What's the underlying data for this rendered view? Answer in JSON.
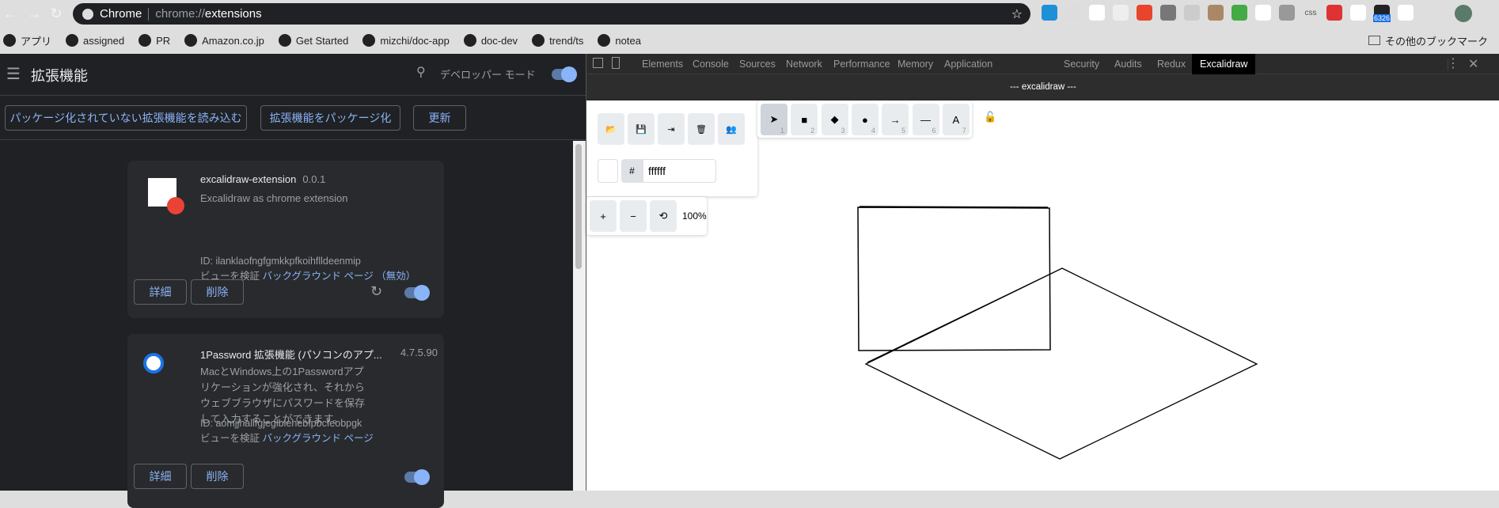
{
  "browser": {
    "tab_label": "Chrome",
    "url_prefix": "chrome://",
    "url_path": "extensions",
    "extension_icons": [
      "hatena-bookmark-icon",
      "react-devtools-icon",
      "1password-icon",
      "camera-icon",
      "lighthouse-icon",
      "lightning-icon",
      "bed-icon",
      "character-icon",
      "color-picker-icon",
      "a-circle-icon",
      "vue-devtools-icon",
      "css-icon",
      "redux-icon",
      "block-icon",
      "badge-icon",
      "excalidraw-icon"
    ],
    "badge_count": "6326",
    "css_label": "css"
  },
  "bookmarks": {
    "items": [
      {
        "label": "アプリ",
        "icon": "apps-grid-icon"
      },
      {
        "label": "assigned",
        "icon": "github-icon"
      },
      {
        "label": "PR",
        "icon": "folder-icon"
      },
      {
        "label": "Amazon.co.jp",
        "icon": "amazon-icon"
      },
      {
        "label": "Get Started",
        "icon": "app-icon"
      },
      {
        "label": "mizchi/doc-app",
        "icon": "github-icon"
      },
      {
        "label": "doc-dev",
        "icon": "firebase-icon"
      },
      {
        "label": "trend/ts",
        "icon": "github-icon"
      },
      {
        "label": "notea",
        "icon": "globe-icon"
      }
    ],
    "other": "その他のブックマーク"
  },
  "extensions_page": {
    "title": "拡張機能",
    "dev_mode": "デベロッパー モード",
    "dev_mode_on": true,
    "buttons": {
      "load_unpacked": "パッケージ化されていない拡張機能を読み込む",
      "pack": "拡張機能をパッケージ化",
      "update": "更新"
    },
    "cards": [
      {
        "name": "excalidraw-extension",
        "version": "0.0.1",
        "description": "Excalidraw as chrome extension",
        "id": "ID: ilanklaofngfgmkkpfkoihflldeenmip",
        "inspect": "ビューを検証",
        "bg_page": "バックグラウンド ページ （無効）",
        "details": "詳細",
        "remove": "削除",
        "enabled": true
      },
      {
        "name": "1Password 拡張機能 (パソコンのアプ...",
        "version": "4.7.5.90",
        "description": "MacとWindows上の1Passwordアプリケーションが強化され、それからウェブブラウザにパスワードを保存して入力することができます。",
        "id": "ID: aomjjhallfgjeglblehebfpbcfeobpgk",
        "inspect": "ビューを検証",
        "bg_page": "バックグラウンド ページ",
        "details": "詳細",
        "remove": "削除",
        "enabled": true
      }
    ]
  },
  "devtools": {
    "tabs": [
      "Elements",
      "Console",
      "Sources",
      "Network",
      "Performance",
      "Memory",
      "Application",
      "Security",
      "Audits",
      "Redux",
      "Excalidraw"
    ],
    "active_tab": "Excalidraw",
    "panel_title": "--- excalidraw ---"
  },
  "excalidraw": {
    "tools": [
      {
        "icon": "pointer-icon",
        "glyph": "➤",
        "key": "1"
      },
      {
        "icon": "rectangle-icon",
        "glyph": "■",
        "key": "2"
      },
      {
        "icon": "diamond-icon",
        "glyph": "◆",
        "key": "3"
      },
      {
        "icon": "ellipse-icon",
        "glyph": "●",
        "key": "4"
      },
      {
        "icon": "arrow-icon",
        "glyph": "→",
        "key": "5"
      },
      {
        "icon": "line-icon",
        "glyph": "—",
        "key": "6"
      },
      {
        "icon": "text-icon",
        "glyph": "A",
        "key": "7"
      }
    ],
    "actions": [
      {
        "icon": "open-icon",
        "glyph": "📂"
      },
      {
        "icon": "save-icon",
        "glyph": "💾"
      },
      {
        "icon": "export-icon",
        "glyph": "⇥"
      },
      {
        "icon": "trash-icon",
        "glyph": "🗑"
      },
      {
        "icon": "collaborate-icon",
        "glyph": "👥"
      }
    ],
    "bg_hash": "#",
    "bg_color": "ffffff",
    "zoom_in": "+",
    "zoom_out": "−",
    "zoom_reset": "⟲",
    "zoom": "100%"
  }
}
